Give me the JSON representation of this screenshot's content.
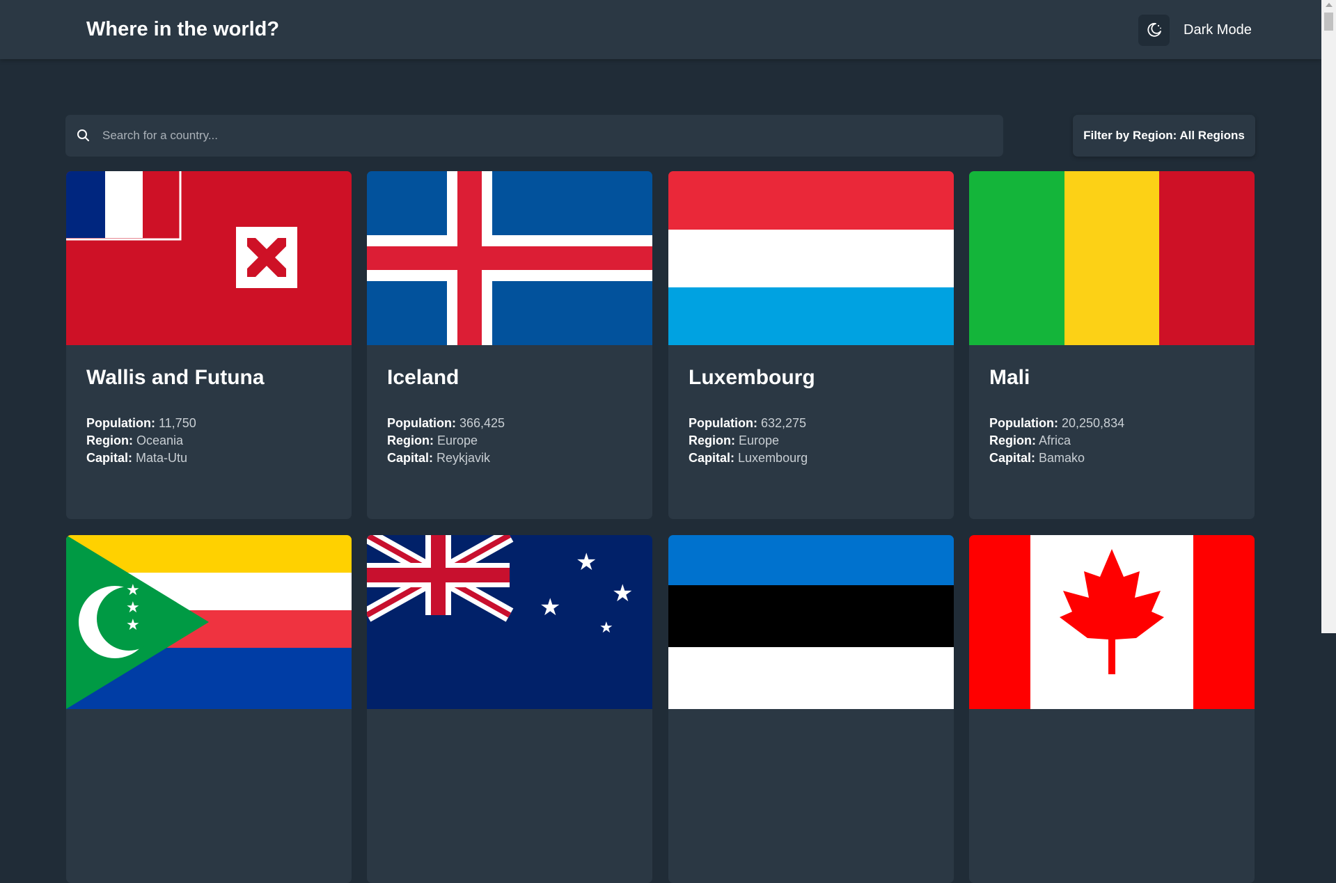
{
  "header": {
    "title": "Where in the world?",
    "mode_label": "Dark Mode",
    "mode_icon": "moon-icon"
  },
  "search": {
    "placeholder": "Search for a country...",
    "value": "",
    "icon": "search-icon"
  },
  "filter": {
    "label": "Filter by Region: All Regions"
  },
  "stat_labels": {
    "population": "Population:",
    "region": "Region:",
    "capital": "Capital:"
  },
  "countries": [
    {
      "name": "Wallis and Futuna",
      "population": "11,750",
      "region": "Oceania",
      "capital": "Mata-Utu",
      "flag": "wallis-futuna-flag"
    },
    {
      "name": "Iceland",
      "population": "366,425",
      "region": "Europe",
      "capital": "Reykjavik",
      "flag": "iceland-flag"
    },
    {
      "name": "Luxembourg",
      "population": "632,275",
      "region": "Europe",
      "capital": "Luxembourg",
      "flag": "luxembourg-flag"
    },
    {
      "name": "Mali",
      "population": "20,250,834",
      "region": "Africa",
      "capital": "Bamako",
      "flag": "mali-flag"
    },
    {
      "name": "",
      "flag": "comoros-flag"
    },
    {
      "name": "",
      "flag": "australia-flag"
    },
    {
      "name": "",
      "flag": "estonia-flag"
    },
    {
      "name": "",
      "flag": "canada-flag"
    }
  ],
  "colors": {
    "background": "#202c37",
    "element": "#2b3844",
    "text": "#ffffff"
  }
}
